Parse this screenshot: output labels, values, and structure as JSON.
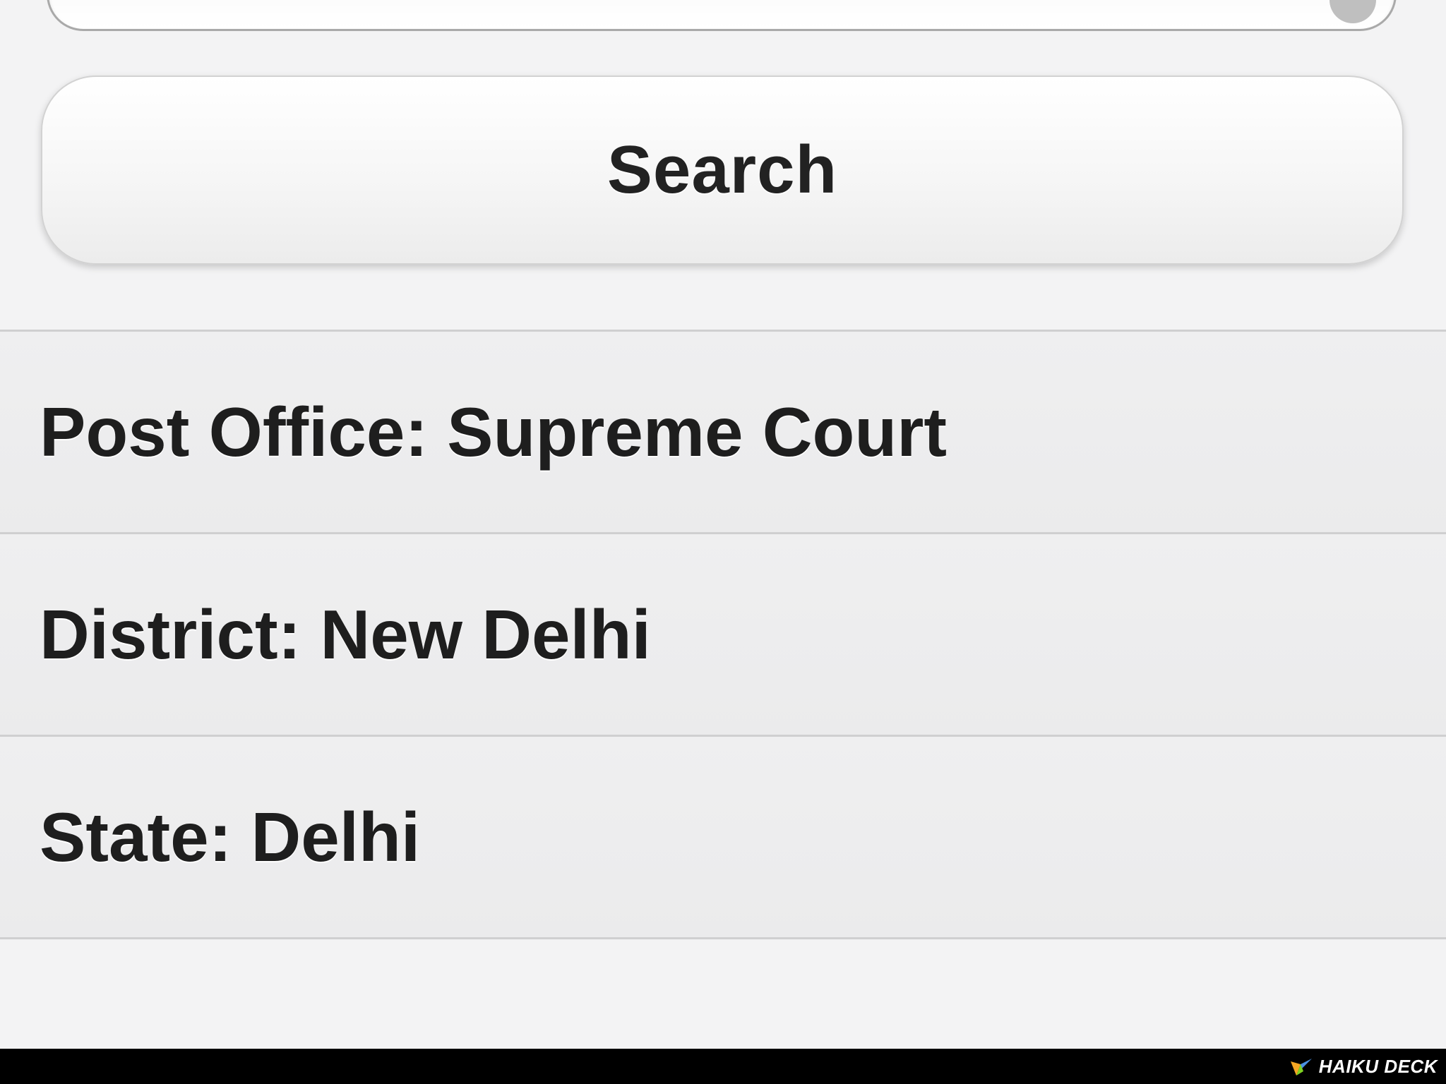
{
  "search": {
    "value": "",
    "button_label": "Search"
  },
  "results": [
    {
      "text": "Post Office: Supreme Court"
    },
    {
      "text": "District: New Delhi"
    },
    {
      "text": "State: Delhi"
    }
  ],
  "footer": {
    "watermark": "HAIKU DECK"
  },
  "colors": {
    "page_background": "#f3f3f4",
    "list_background": "#ededee",
    "divider": "#cfcfd0",
    "text": "#1e1e1e",
    "footer_bar": "#000000"
  },
  "icons": {
    "clear": "clear-icon",
    "logo": "haiku-deck-logo-icon"
  }
}
